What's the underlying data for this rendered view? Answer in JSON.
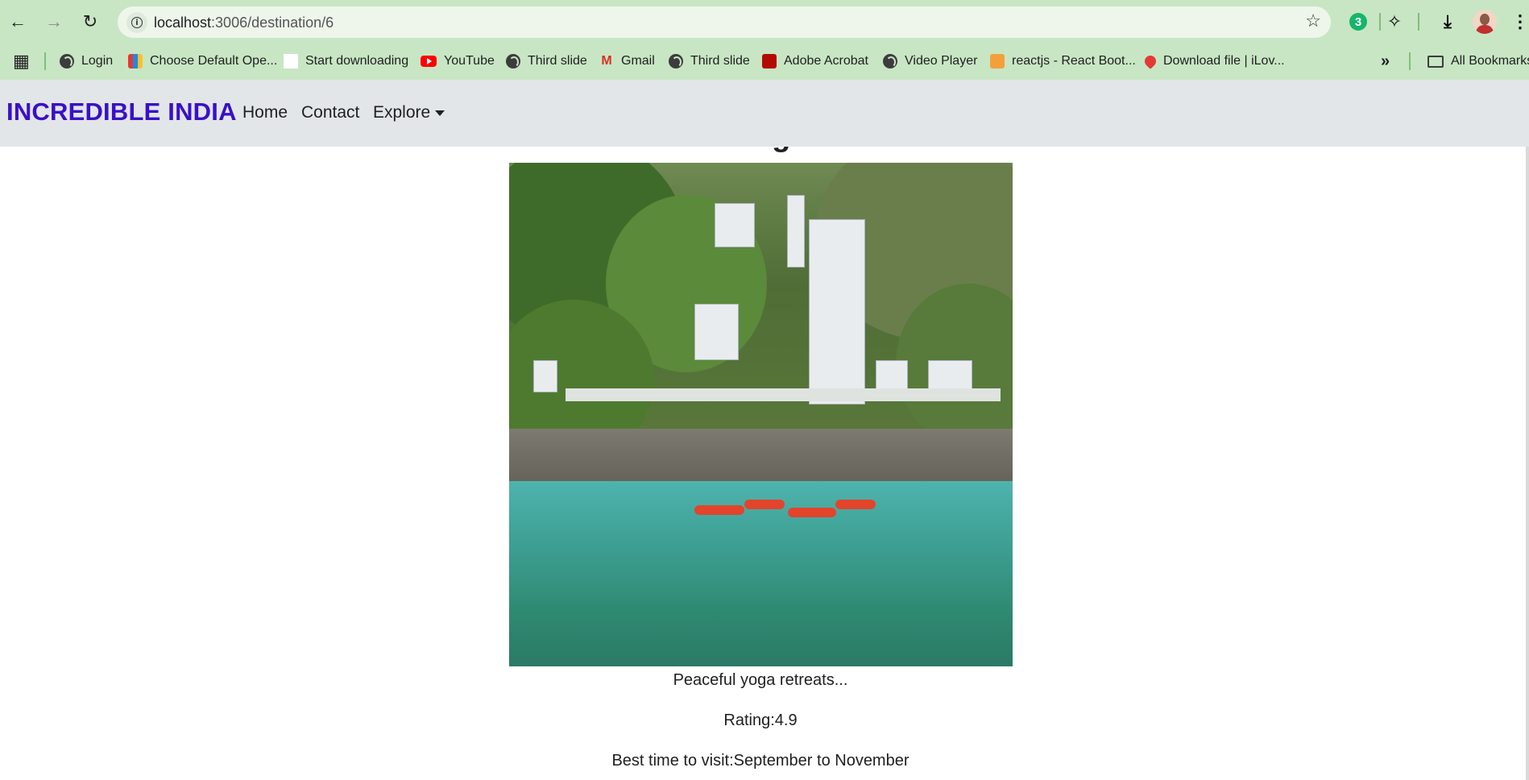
{
  "browser": {
    "url_host": "localhost",
    "url_path": ":3006/destination/6",
    "extension_badge": "3",
    "bookmarks": [
      {
        "label": "Login",
        "icon": "globe-icon"
      },
      {
        "label": "Choose Default Ope...",
        "icon": "app-icon"
      },
      {
        "label": "Start downloading",
        "icon": "page-icon"
      },
      {
        "label": "YouTube",
        "icon": "youtube-icon"
      },
      {
        "label": "Third slide",
        "icon": "globe-icon"
      },
      {
        "label": "Gmail",
        "icon": "gmail-icon"
      },
      {
        "label": "Third slide",
        "icon": "globe-icon"
      },
      {
        "label": "Adobe Acrobat",
        "icon": "acrobat-icon"
      },
      {
        "label": "Video Player",
        "icon": "globe-icon"
      },
      {
        "label": "reactjs - React Boot...",
        "icon": "stackoverflow-icon"
      },
      {
        "label": "Download file | iLov...",
        "icon": "heart-icon"
      }
    ],
    "all_bookmarks_label": "All Bookmarks"
  },
  "navbar": {
    "brand": "INCREDIBLE INDIA",
    "links": [
      "Home",
      "Contact",
      "Explore"
    ]
  },
  "destination": {
    "title": "Rishikesh Yoga Retreats",
    "description": "Peaceful yoga retreats...",
    "rating": "Rating:4.9",
    "best_time": "Best time to visit:September to November"
  },
  "colors": {
    "brand": "#3a10c6",
    "chrome": "#c8e6c4",
    "navbar_bg": "#e2e6e9"
  }
}
